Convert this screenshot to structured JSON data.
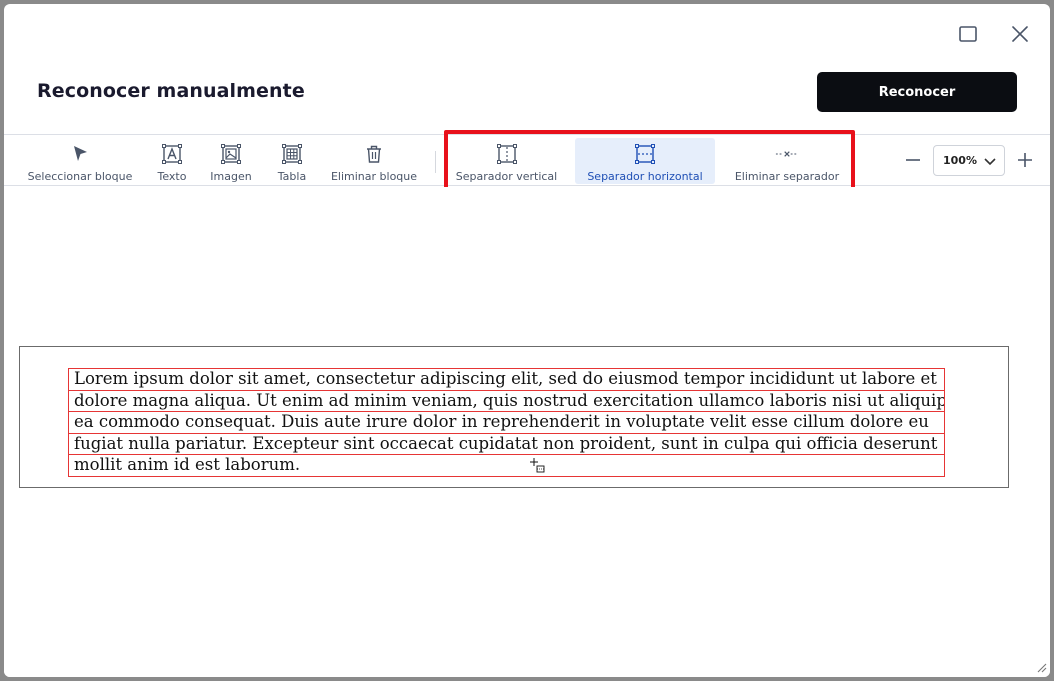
{
  "dialog": {
    "title": "Reconocer manualmente",
    "primary_button": "Reconocer"
  },
  "toolbar": {
    "tools": [
      {
        "label": "Seleccionar bloque",
        "icon": "cursor-arrow-icon"
      },
      {
        "label": "Texto",
        "icon": "text-block-icon"
      },
      {
        "label": "Imagen",
        "icon": "image-block-icon"
      },
      {
        "label": "Tabla",
        "icon": "table-block-icon"
      },
      {
        "label": "Eliminar bloque",
        "icon": "trash-icon"
      },
      {
        "label": "Separador vertical",
        "icon": "vertical-separator-icon"
      },
      {
        "label": "Separador horizontal",
        "icon": "horizontal-separator-icon",
        "active": true
      },
      {
        "label": "Eliminar separador",
        "icon": "remove-separator-icon"
      }
    ],
    "zoom": {
      "value": "100%"
    }
  },
  "document": {
    "lines": [
      "Lorem ipsum dolor sit amet, consectetur adipiscing elit, sed do eiusmod tempor incididunt ut labore et",
      "dolore magna aliqua. Ut enim ad minim veniam, quis nostrud exercitation ullamco laboris nisi ut aliquip ex",
      "ea commodo consequat. Duis aute irure dolor in reprehenderit in voluptate velit esse cillum dolore eu",
      "fugiat nulla pariatur. Excepteur sint occaecat cupidatat non proident, sunt in culpa qui officia deserunt",
      "mollit anim id est laborum."
    ]
  },
  "colors": {
    "primary_button_bg": "#0b0d12",
    "active_tool_bg": "#e6eefb",
    "active_tool_text": "#1f4fb5",
    "highlight": "#e8111b",
    "text_line_border": "#e63535"
  }
}
